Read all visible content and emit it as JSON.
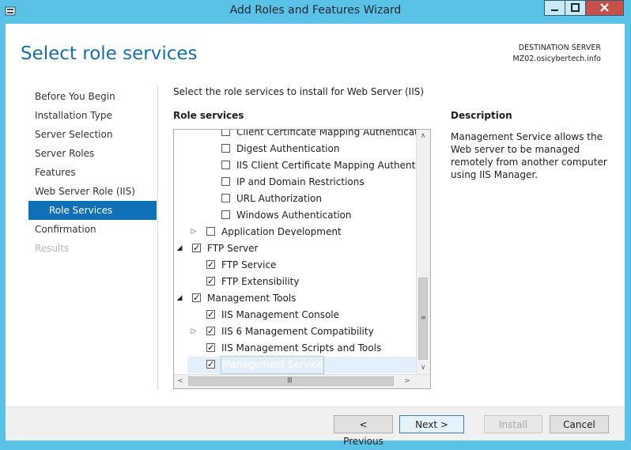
{
  "window": {
    "title": "Add Roles and Features Wizard",
    "min_label": "▁",
    "max_label": "□",
    "close_label": "X"
  },
  "header": {
    "title": "Select role services",
    "destination_label": "DESTINATION SERVER",
    "destination_value": "MZ02.osicybertech.info"
  },
  "nav": {
    "items": [
      {
        "label": "Before You Begin"
      },
      {
        "label": "Installation Type"
      },
      {
        "label": "Server Selection"
      },
      {
        "label": "Server Roles"
      },
      {
        "label": "Features"
      },
      {
        "label": "Web Server Role (IIS)"
      },
      {
        "label": "Role Services"
      },
      {
        "label": "Confirmation"
      },
      {
        "label": "Results"
      }
    ]
  },
  "main": {
    "intro": "Select the role services to install for Web Server (IIS)",
    "role_services_header": "Role services",
    "description_header": "Description",
    "description": "Management Service allows the Web server to be managed remotely from another computer using IIS Manager."
  },
  "tree": {
    "items": [
      {
        "label": "Client Certificate Mapping Authentication",
        "checked": false
      },
      {
        "label": "Digest Authentication",
        "checked": false
      },
      {
        "label": "IIS Client Certificate Mapping Authentication",
        "checked": false
      },
      {
        "label": "IP and Domain Restrictions",
        "checked": false
      },
      {
        "label": "URL Authorization",
        "checked": false
      },
      {
        "label": "Windows Authentication",
        "checked": false
      },
      {
        "label": "Application Development",
        "checked": false
      },
      {
        "label": "FTP Server",
        "checked": true
      },
      {
        "label": "FTP Service",
        "checked": true
      },
      {
        "label": "FTP Extensibility",
        "checked": true
      },
      {
        "label": "Management Tools",
        "checked": true
      },
      {
        "label": "IIS Management Console",
        "checked": true
      },
      {
        "label": "IIS 6 Management Compatibility",
        "checked": true
      },
      {
        "label": "IIS Management Scripts and Tools",
        "checked": true
      },
      {
        "label": "Management Service",
        "checked": true,
        "selected": true
      }
    ],
    "checkmark": "✓",
    "expander_collapsed": "▷",
    "expander_expanded": "◢",
    "scroll_up": "∧",
    "scroll_down": "∨",
    "scroll_left": "<",
    "scroll_right": ">",
    "grip_h": "III",
    "grip_v": "≡"
  },
  "buttons": {
    "previous": "< Previous",
    "next": "Next >",
    "install": "Install",
    "cancel": "Cancel"
  }
}
